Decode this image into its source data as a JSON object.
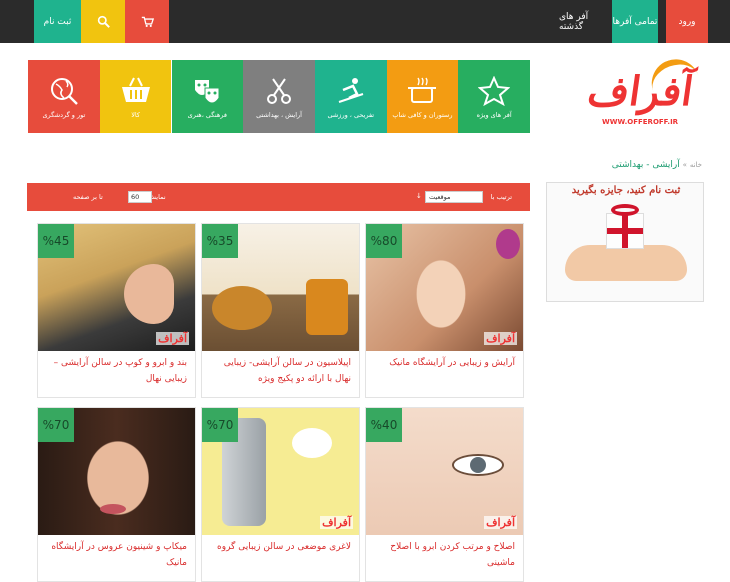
{
  "topbar": {
    "login": "ورود",
    "all_offers": "تمامی آفرها",
    "past_offers": "آفر های گذشته",
    "register": "ثبت نام",
    "icons": {
      "search": "search-icon",
      "cart": "cart-icon"
    },
    "colors": {
      "bg": "#2b2b2b",
      "green": "#1fb38e",
      "yellow": "#f1c40f",
      "red": "#e74c3c"
    }
  },
  "logo": {
    "text": "آفراف",
    "url": "WWW.OFFEROFF.IR"
  },
  "categories": [
    {
      "label": "آفر های ویژه",
      "color": "#27ae60",
      "icon": "star-icon"
    },
    {
      "label": "رستوران و کافی شاپ",
      "color": "#f39c12",
      "icon": "pot-icon"
    },
    {
      "label": "تفریحی ، ورزشی",
      "color": "#1fb38e",
      "icon": "ski-icon"
    },
    {
      "label": "آرایش ، بهداشتی",
      "color": "#7f7f7f",
      "icon": "scissors-icon"
    },
    {
      "label": "فرهنگی ،هنری",
      "color": "#27ae60",
      "icon": "masks-icon"
    },
    {
      "label": "کالا",
      "color": "#f1c40f",
      "icon": "basket-icon"
    },
    {
      "label": "تور و گردشگری",
      "color": "#e74c3c",
      "icon": "globe-icon"
    }
  ],
  "breadcrumb": {
    "home": "خانه",
    "sep": "»",
    "current": "آرایشی - بهداشتی"
  },
  "sortbar": {
    "sort_label": "ترتیب با",
    "sort_value": "موقعیت",
    "show_label": "نمایش",
    "show_value": "60",
    "per_page": "تا بر صفحه"
  },
  "banner": {
    "text": "ثبت نام کنید، جایزه بگیرید"
  },
  "products": [
    {
      "discount": "%80",
      "title": "آرایش و زیبایی در آرایشگاه مانیک"
    },
    {
      "discount": "%35",
      "title": "اپیلاسیون در سالن آرایشی- زیبایی نهال با ارائه دو پکیج ویژه"
    },
    {
      "discount": "%45",
      "title": "بند و ابرو و کوپ در سالن آرایشی – زیبایی نهال"
    },
    {
      "discount": "%40",
      "title": "اصلاح و مرتب کردن ابرو با اصلاح ماشینی"
    },
    {
      "discount": "%70",
      "title": "لاغری موضعی در سالن زیبایی گروه"
    },
    {
      "discount": "%70",
      "title": "میکاپ و شینیون عروس در آرایشگاه مانیک"
    }
  ],
  "watermark": "آفراف"
}
